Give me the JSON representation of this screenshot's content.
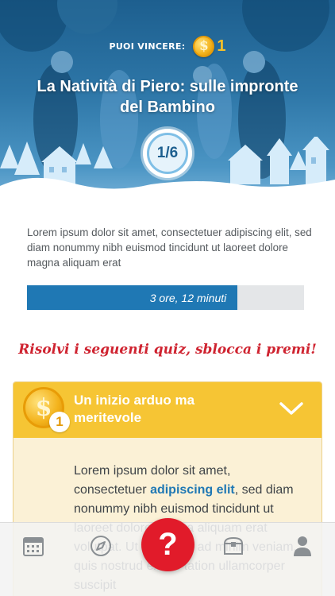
{
  "hero": {
    "prize_label": "PUOI VINCERE:",
    "prize_coin_symbol": "$",
    "prize_count": "1",
    "title": "La Natività di Piero: sulle impronte del Bambino",
    "counter": "1/6"
  },
  "description": "Lorem ipsum dolor sit amet, consectetuer adipiscing elit, sed diam nonummy nibh euismod tincidunt ut laoreet dolore magna aliquam erat",
  "progress": {
    "label": "3 ore, 12 minuti",
    "fraction": 0.76
  },
  "cta": "Risolvi i seguenti quiz, sblocca i premi!",
  "quiz_card": {
    "coin_symbol": "$",
    "coin_count": "1",
    "title": "Un inizio arduo ma meritevole",
    "body_before": "Lorem ipsum dolor sit amet, consectetuer ",
    "body_link": "adipiscing elit",
    "body_after": ", sed diam nonummy nibh euismod tincidunt ut laoreet dolore magna aliquam erat volutpat. Ut wisi enim ad minim veniam, quis nostrud exerci tation ullamcorper suscipit"
  },
  "tabbar": {
    "fab_label": "?",
    "icons": [
      "calendar-icon",
      "compass-icon",
      "question-icon",
      "chest-icon",
      "user-icon"
    ]
  },
  "colors": {
    "accent_blue": "#1f78b4",
    "cta_red": "#cf2330",
    "card_header": "#f6c534",
    "fab_red": "#e11b2a"
  }
}
